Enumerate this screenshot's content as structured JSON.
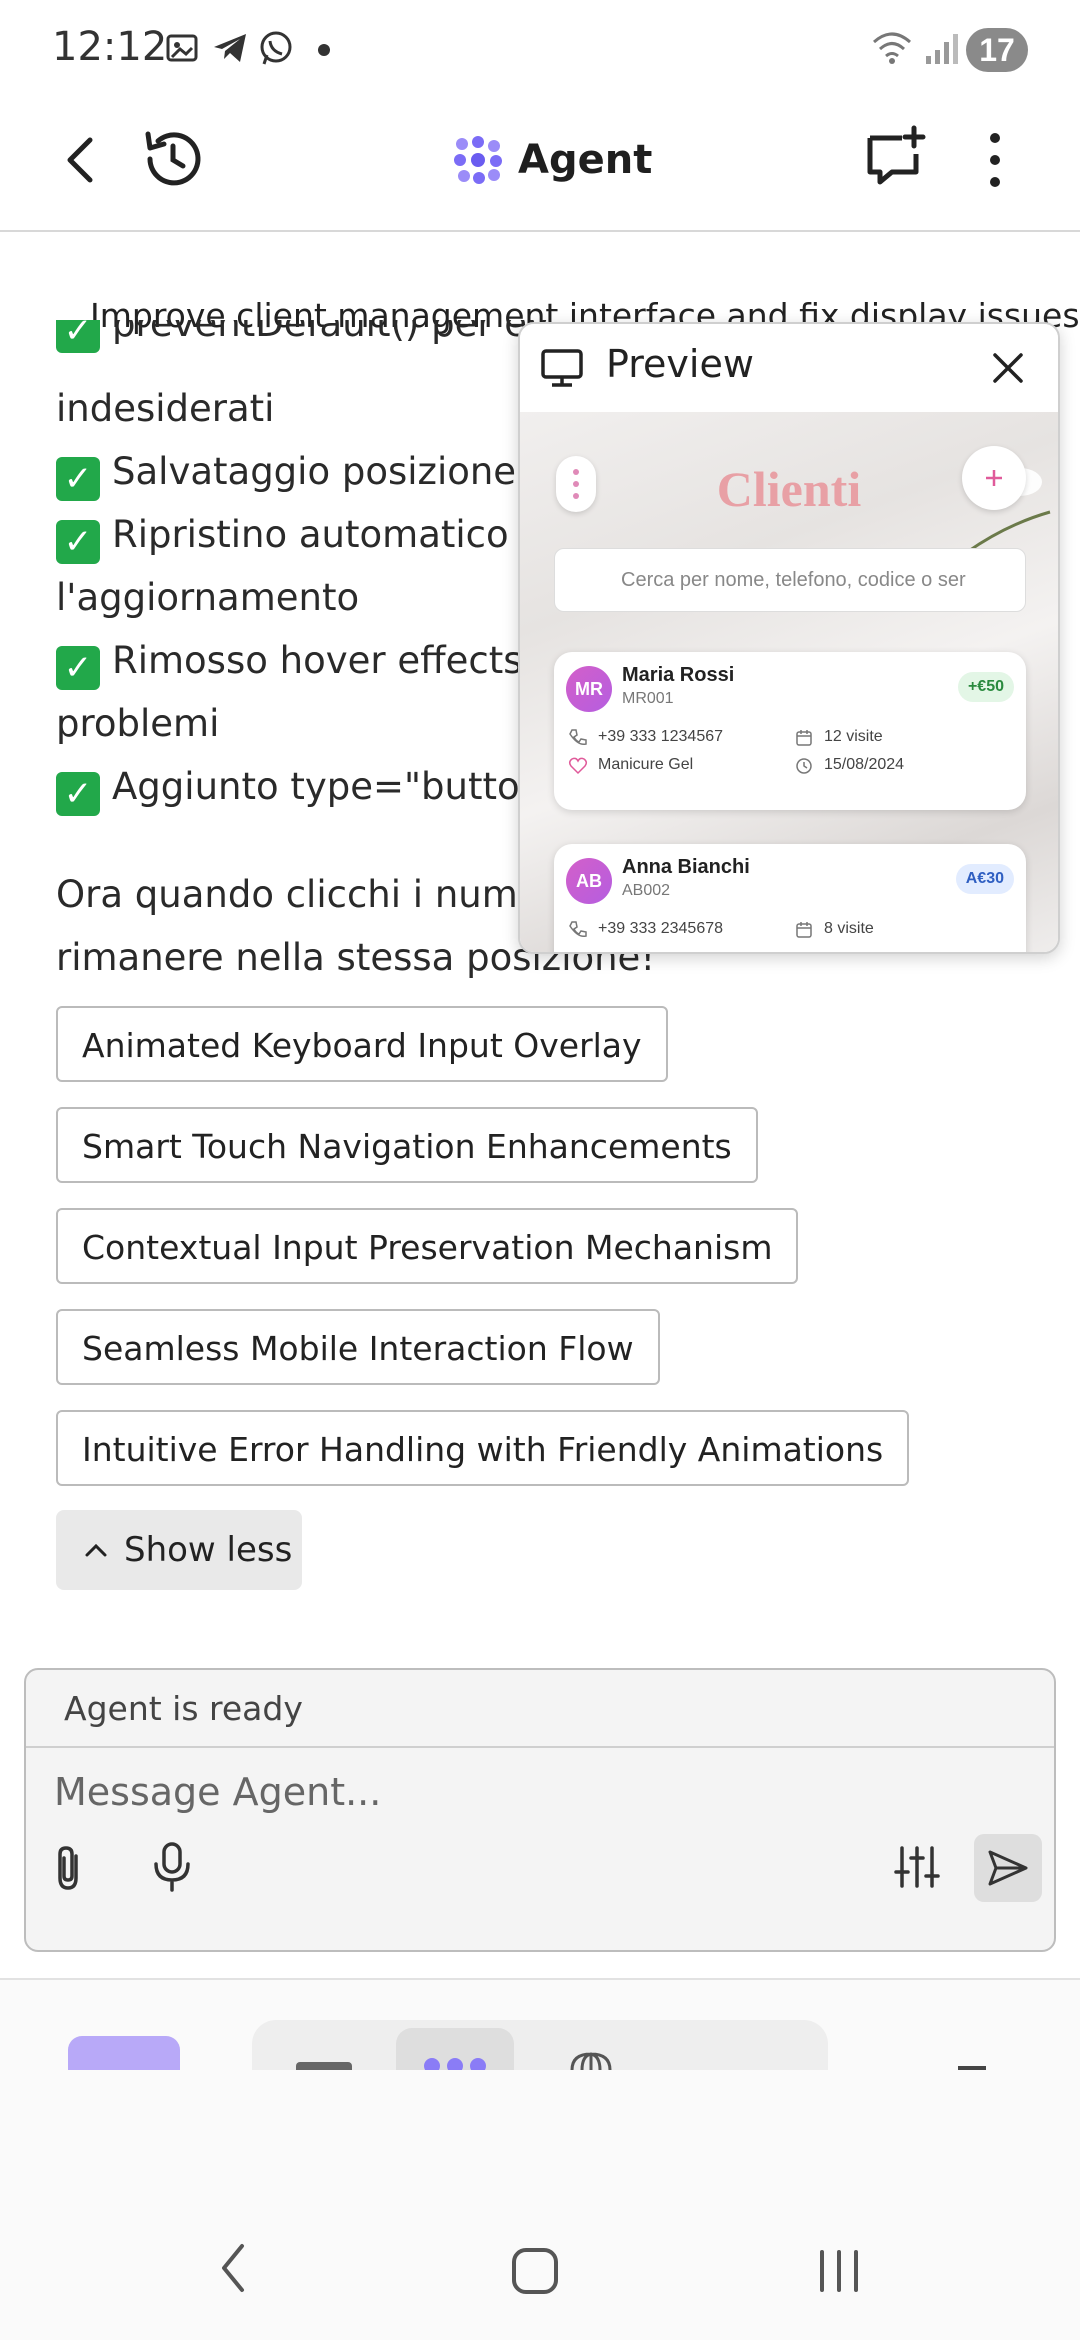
{
  "status_bar": {
    "time": "12:12",
    "battery": "17"
  },
  "header": {
    "title": "Agent"
  },
  "chat": {
    "task_title": "Improve client management interface and fix display issues",
    "lines": [
      "preventDefault() per ev",
      "indesiderati",
      "Salvataggio posizione s",
      "Ripristino automatico d",
      "l'aggiornamento",
      "Rimosso hover effects c",
      "problemi",
      "Aggiunto type=\"button\""
    ],
    "closing_line1": "Ora quando clicchi i numer",
    "closing_line2": "rimanere nella stessa posizione!"
  },
  "suggestions": [
    "Animated Keyboard Input Overlay",
    "Smart Touch Navigation Enhancements",
    "Contextual Input Preservation Mechanism",
    "Seamless Mobile Interaction Flow",
    "Intuitive Error Handling with Friendly Animations"
  ],
  "show_less_label": "Show less",
  "input": {
    "status": "Agent is ready",
    "placeholder": "Message Agent..."
  },
  "preview": {
    "title": "Preview",
    "app_title": "Clienti",
    "search_placeholder": "Cerca per nome, telefono, codice o ser",
    "clients": [
      {
        "initials": "MR",
        "name": "Maria Rossi",
        "code": "MR001",
        "badge": "+€50",
        "phone": "+39 333 1234567",
        "visits": "12 visite",
        "service": "Manicure Gel",
        "date": "15/08/2024"
      },
      {
        "initials": "AB",
        "name": "Anna Bianchi",
        "code": "AB002",
        "badge": "A€30",
        "phone": "+39 333 2345678",
        "visits": "8 visite"
      }
    ]
  },
  "colors": {
    "accent": "#7b6cf6",
    "check_green": "#22a84a",
    "clienti_pink": "#e8a0a5",
    "badge_green_bg": "#e3f6e6",
    "badge_blue_bg": "#e2ecff"
  }
}
